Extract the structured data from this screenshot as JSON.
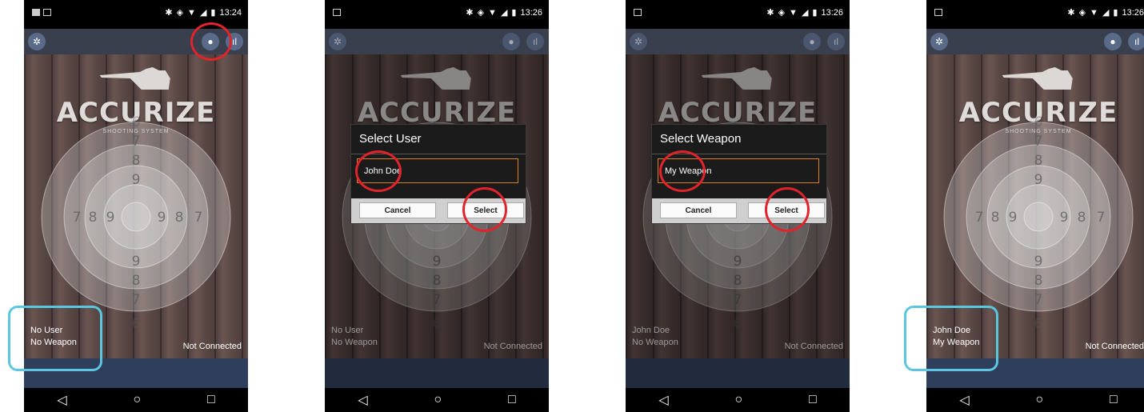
{
  "screens": [
    {
      "time": "13:24",
      "user": "No User",
      "weapon": "No Weapon",
      "connection": "Not Connected"
    },
    {
      "time": "13:26",
      "user": "No User",
      "weapon": "No Weapon",
      "connection": "Not Connected",
      "dialog": {
        "title": "Select User",
        "item": "John Doe",
        "cancel": "Cancel",
        "select": "Select"
      }
    },
    {
      "time": "13:26",
      "user": "John Doe",
      "weapon": "No Weapon",
      "connection": "Not Connected",
      "dialog": {
        "title": "Select Weapon",
        "item": "My Weapon",
        "cancel": "Cancel",
        "select": "Select"
      }
    },
    {
      "time": "13:26",
      "user": "John Doe",
      "weapon": "My Weapon",
      "connection": "Not Connected"
    }
  ],
  "logo": {
    "text": "ACCURIZE",
    "subtitle": "SHOOTING SYSTEM"
  },
  "toolbar": {
    "settings_icon": "gear-icon",
    "user_icon": "user-icon",
    "stats_icon": "bar-chart-icon"
  },
  "navbar": {
    "back_icon": "back-triangle-icon",
    "home_icon": "home-circle-icon",
    "recents_icon": "recents-square-icon"
  },
  "colors": {
    "toolbar_bg": "#3a3f4d",
    "button_bg": "#5a6b8a",
    "dialog_border": "#d9801f",
    "annotation_red": "#e0242a",
    "annotation_blue": "#5bc6e0",
    "bottom_bar": "#2f3e5a"
  }
}
